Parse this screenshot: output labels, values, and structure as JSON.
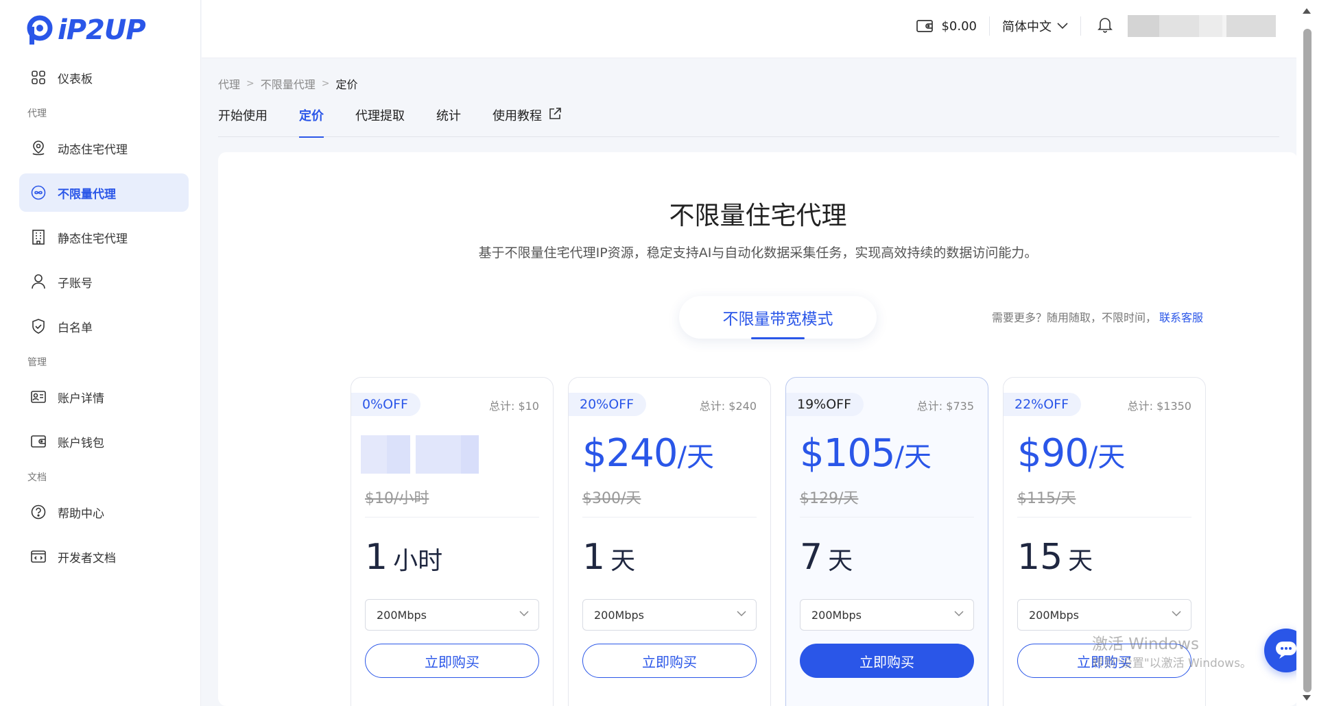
{
  "brand": {
    "logo_text": "iP2UP",
    "accent": "#2a56e8"
  },
  "sidebar": {
    "dashboard": "仪表板",
    "sections": {
      "proxy": "代理",
      "manage": "管理",
      "docs": "文档"
    },
    "items": [
      {
        "label": "动态住宅代理",
        "icon": "location-pin-icon"
      },
      {
        "label": "不限量代理",
        "icon": "infinity-icon",
        "active": true
      },
      {
        "label": "静态住宅代理",
        "icon": "building-icon"
      },
      {
        "label": "子账号",
        "icon": "user-icon"
      },
      {
        "label": "白名单",
        "icon": "shield-icon"
      },
      {
        "label": "账户详情",
        "icon": "id-card-icon"
      },
      {
        "label": "账户钱包",
        "icon": "wallet-icon"
      },
      {
        "label": "帮助中心",
        "icon": "help-icon"
      },
      {
        "label": "开发者文档",
        "icon": "code-doc-icon"
      }
    ]
  },
  "header": {
    "balance": "$0.00",
    "language": "简体中文"
  },
  "breadcrumb": [
    "代理",
    "不限量代理",
    "定价"
  ],
  "tabs": [
    "开始使用",
    "定价",
    "代理提取",
    "统计",
    "使用教程"
  ],
  "main": {
    "title": "不限量住宅代理",
    "subtitle": "基于不限量住宅代理IP资源，稳定支持AI与自动化数据采集任务，实现高效持续的数据访问能力。",
    "mode": "不限量带宽模式",
    "need_more_text": "需要更多？随用随取，不限时间，",
    "contact_link": "联系客服"
  },
  "plans": [
    {
      "discount": "0%OFF",
      "total": "总计: $10",
      "price": "",
      "unit": "",
      "original": "$10/小时",
      "duration_num": "1",
      "duration_unit": "小时",
      "bandwidth": "200Mbps",
      "button": "立即购买",
      "featured": false
    },
    {
      "discount": "20%OFF",
      "total": "总计: $240",
      "price": "$240",
      "unit": "/天",
      "original": "$300/天",
      "duration_num": "1",
      "duration_unit": "天",
      "bandwidth": "200Mbps",
      "button": "立即购买",
      "featured": false
    },
    {
      "discount": "19%OFF",
      "total": "总计: $735",
      "price": "$105",
      "unit": "/天",
      "original": "$129/天",
      "duration_num": "7",
      "duration_unit": "天",
      "bandwidth": "200Mbps",
      "button": "立即购买",
      "featured": true
    },
    {
      "discount": "22%OFF",
      "total": "总计: $1350",
      "price": "$90",
      "unit": "/天",
      "original": "$115/天",
      "duration_num": "15",
      "duration_unit": "天",
      "bandwidth": "200Mbps",
      "button": "立即购买",
      "featured": false
    }
  ],
  "watermark": {
    "line1": "激活 Windows",
    "line2": "转到\"设置\"以激活 Windows。"
  }
}
